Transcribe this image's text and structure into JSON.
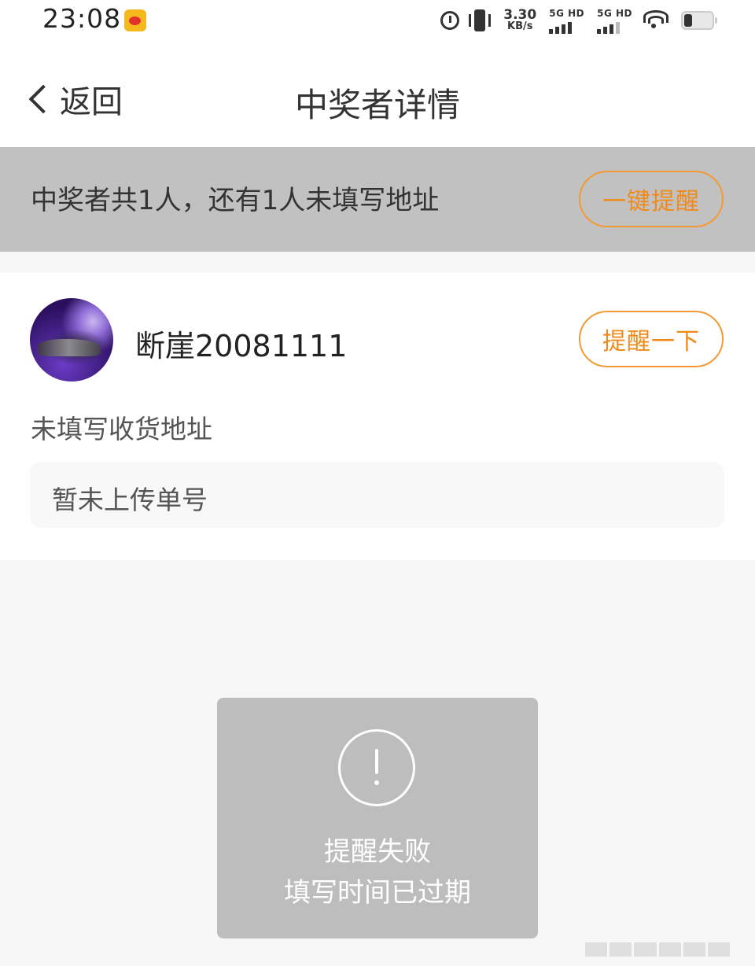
{
  "status_bar": {
    "time": "23:08",
    "net_speed_value": "3.30",
    "net_speed_unit": "KB/s",
    "sim1_label": "5G HD",
    "sim2_label": "5G HD",
    "app_notification_icon": "weibo-icon"
  },
  "nav": {
    "back_label": "返回",
    "title": "中奖者详情"
  },
  "summary": {
    "text": "中奖者共1人，还有1人未填写地址",
    "remind_all_label": "一键提醒"
  },
  "winner": {
    "username": "断崖20081111",
    "remind_label": "提醒一下",
    "address_status": "未填写收货地址",
    "tracking_status": "暂未上传单号"
  },
  "toast": {
    "icon": "exclamation-circle-icon",
    "line1": "提醒失败",
    "line2": "填写时间已过期"
  },
  "colors": {
    "accent": "#f08a1a",
    "summary_bg": "#c1c1c1",
    "toast_bg": "#bdbdbd",
    "page_bg": "#f7f7f7"
  }
}
